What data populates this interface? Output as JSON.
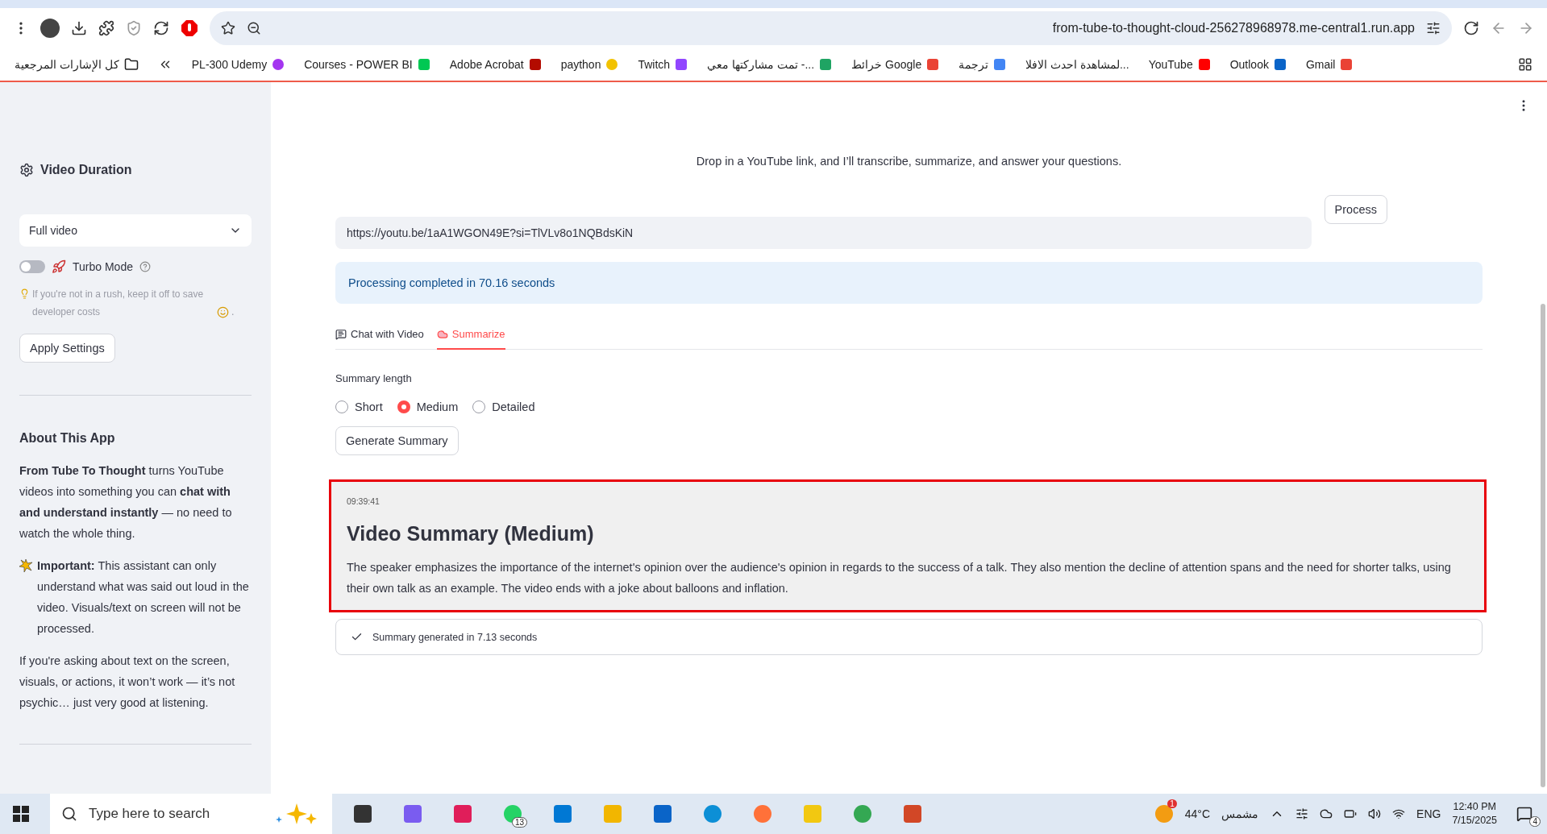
{
  "browser": {
    "address": "from-tube-to-thought-cloud-256278968978.me-central1.run.app",
    "all_bookmarks": "كل الإشارات المرجعية",
    "bookmarks": [
      {
        "label": "PL-300 Udemy",
        "kind": "udemy"
      },
      {
        "label": "Courses - POWER BI",
        "kind": "powerbi"
      },
      {
        "label": "Adobe Acrobat",
        "kind": "acrobat"
      },
      {
        "label": "paython",
        "kind": "bulb"
      },
      {
        "label": "Twitch",
        "kind": "twitch"
      },
      {
        "label": "تمت مشاركتها معي -...",
        "kind": "drive"
      },
      {
        "label": "خرائط Google",
        "kind": "maps"
      },
      {
        "label": "ترجمة",
        "kind": "translate"
      },
      {
        "label": "لمشاهدة احدث الافلا...",
        "kind": "none"
      },
      {
        "label": "YouTube",
        "kind": "youtube"
      },
      {
        "label": "Outlook",
        "kind": "outlook"
      },
      {
        "label": "Gmail",
        "kind": "gmail"
      }
    ]
  },
  "sidebar": {
    "title": "Video Duration",
    "duration": {
      "value": "Full video"
    },
    "turbo": {
      "label": "Turbo Mode",
      "on": false
    },
    "hint": "If you're not in a rush, keep it off to save developer costs",
    "hint_end": ".",
    "apply_button": "Apply Settings",
    "about_title": "About This App",
    "about": [
      {
        "kind": "plain",
        "text": "**From Tube To Thought** turns YouTube videos into something you can **chat with and understand instantly** — no need to watch the whole thing."
      },
      {
        "kind": "important",
        "text": "**Important:** This assistant can only understand what was said out loud in the video. Visuals/text on screen will not be processed."
      },
      {
        "kind": "plain",
        "text": "If you're asking about text on the screen, visuals, or actions, it won’t work — it’s not psychic… just very good at listening."
      }
    ]
  },
  "main": {
    "subtitle": "Drop in a YouTube link, and I’ll transcribe, summarize, and answer your questions.",
    "url_field": {
      "value": "https://youtu.be/1aA1WGON49E?si=TlVLv8o1NQBdsKiN"
    },
    "process_button": "Process",
    "status": "Processing completed in 70.16 seconds",
    "tabs": [
      {
        "label": "Chat with Video",
        "kind": "chat",
        "selected": false
      },
      {
        "label": "Summarize",
        "kind": "brain",
        "selected": true
      }
    ],
    "summary_length": {
      "label": "Summary length",
      "options": [
        {
          "label": "Short",
          "selected": false
        },
        {
          "label": "Medium",
          "selected": true
        },
        {
          "label": "Detailed",
          "selected": false
        }
      ]
    },
    "generate_button": "Generate Summary",
    "summary": {
      "time": "09:39:41",
      "title": "Video Summary (Medium)",
      "text": "The speaker emphasizes the importance of the internet's opinion over the audience's opinion in regards to the success of a talk. They also mention the decline of attention spans and the need for shorter talks, using their own talk as an example. The video ends with a joke about balloons and inflation."
    },
    "success": "Summary generated in 7.13 seconds"
  },
  "taskbar": {
    "search_placeholder": "Type here to search",
    "apps": [
      {
        "kind": "taskview"
      },
      {
        "kind": "copilot"
      },
      {
        "kind": "slack"
      },
      {
        "kind": "whatsapp",
        "badge": "13"
      },
      {
        "kind": "vscode"
      },
      {
        "kind": "files"
      },
      {
        "kind": "outlook"
      },
      {
        "kind": "edge"
      },
      {
        "kind": "firefox"
      },
      {
        "kind": "powerbi"
      },
      {
        "kind": "chrome"
      },
      {
        "kind": "powerpoint"
      }
    ],
    "weather_badge": "1",
    "temperature": "44°C",
    "weather": "مشمس",
    "language": "ENG",
    "time": "12:40 PM",
    "date": "7/15/2025",
    "notifications": "4"
  }
}
